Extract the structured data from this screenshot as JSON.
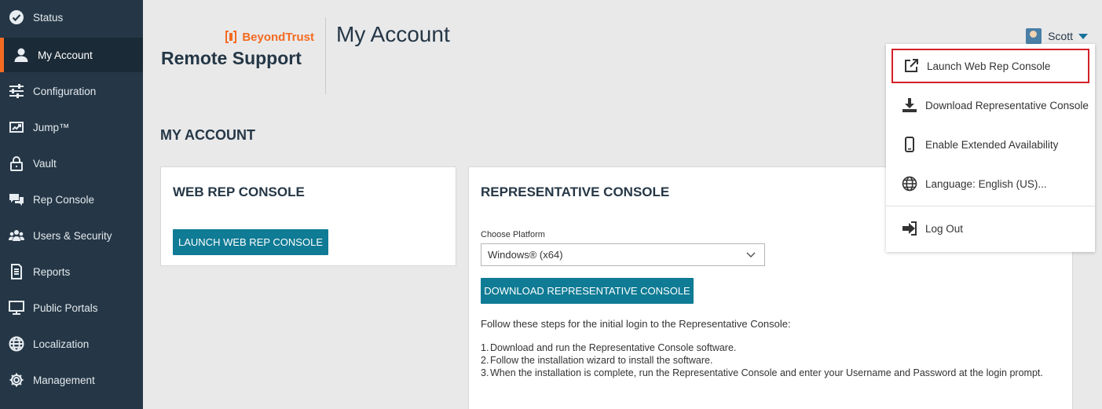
{
  "sidebar": {
    "items": [
      {
        "label": "Status",
        "icon": "check-circle-icon"
      },
      {
        "label": "My Account",
        "icon": "user-icon",
        "active": true
      },
      {
        "label": "Configuration",
        "icon": "sliders-icon"
      },
      {
        "label": "Jump™",
        "icon": "jump-icon"
      },
      {
        "label": "Vault",
        "icon": "lock-icon"
      },
      {
        "label": "Rep Console",
        "icon": "chat-icon"
      },
      {
        "label": "Users & Security",
        "icon": "users-icon"
      },
      {
        "label": "Reports",
        "icon": "report-icon"
      },
      {
        "label": "Public Portals",
        "icon": "monitor-icon"
      },
      {
        "label": "Localization",
        "icon": "globe-icon"
      },
      {
        "label": "Management",
        "icon": "gear-icon"
      }
    ]
  },
  "header": {
    "brand": "BeyondTrust",
    "product": "Remote Support",
    "page_title": "My Account",
    "user_name": "Scott"
  },
  "main": {
    "section_title": "MY ACCOUNT",
    "web_rep_console": {
      "title": "WEB REP CONSOLE",
      "button_label": "LAUNCH WEB REP CONSOLE"
    },
    "representative_console": {
      "title": "REPRESENTATIVE CONSOLE",
      "platform_label": "Choose Platform",
      "platform_value": "Windows® (x64)",
      "button_label": "DOWNLOAD REPRESENTATIVE CONSOLE",
      "steps_intro": "Follow these steps for the initial login to the Representative Console:",
      "steps": [
        "Download and run the Representative Console software.",
        "Follow the installation wizard to install the software.",
        "When the installation is complete, run the Representative Console and enter your Username and Password at the login prompt."
      ]
    }
  },
  "user_dropdown": {
    "items": [
      {
        "label": "Launch Web Rep Console",
        "icon": "external-link-icon"
      },
      {
        "label": "Download Representative Console",
        "icon": "download-icon"
      },
      {
        "label": "Enable Extended Availability",
        "icon": "mobile-icon"
      },
      {
        "label": "Language: English (US)...",
        "icon": "globe-icon"
      },
      {
        "label": "Log Out",
        "icon": "logout-icon"
      }
    ]
  },
  "colors": {
    "sidebar_bg": "#253746",
    "accent_orange": "#f36b21",
    "button_teal": "#0f7b94",
    "highlight_red": "#d32027"
  }
}
